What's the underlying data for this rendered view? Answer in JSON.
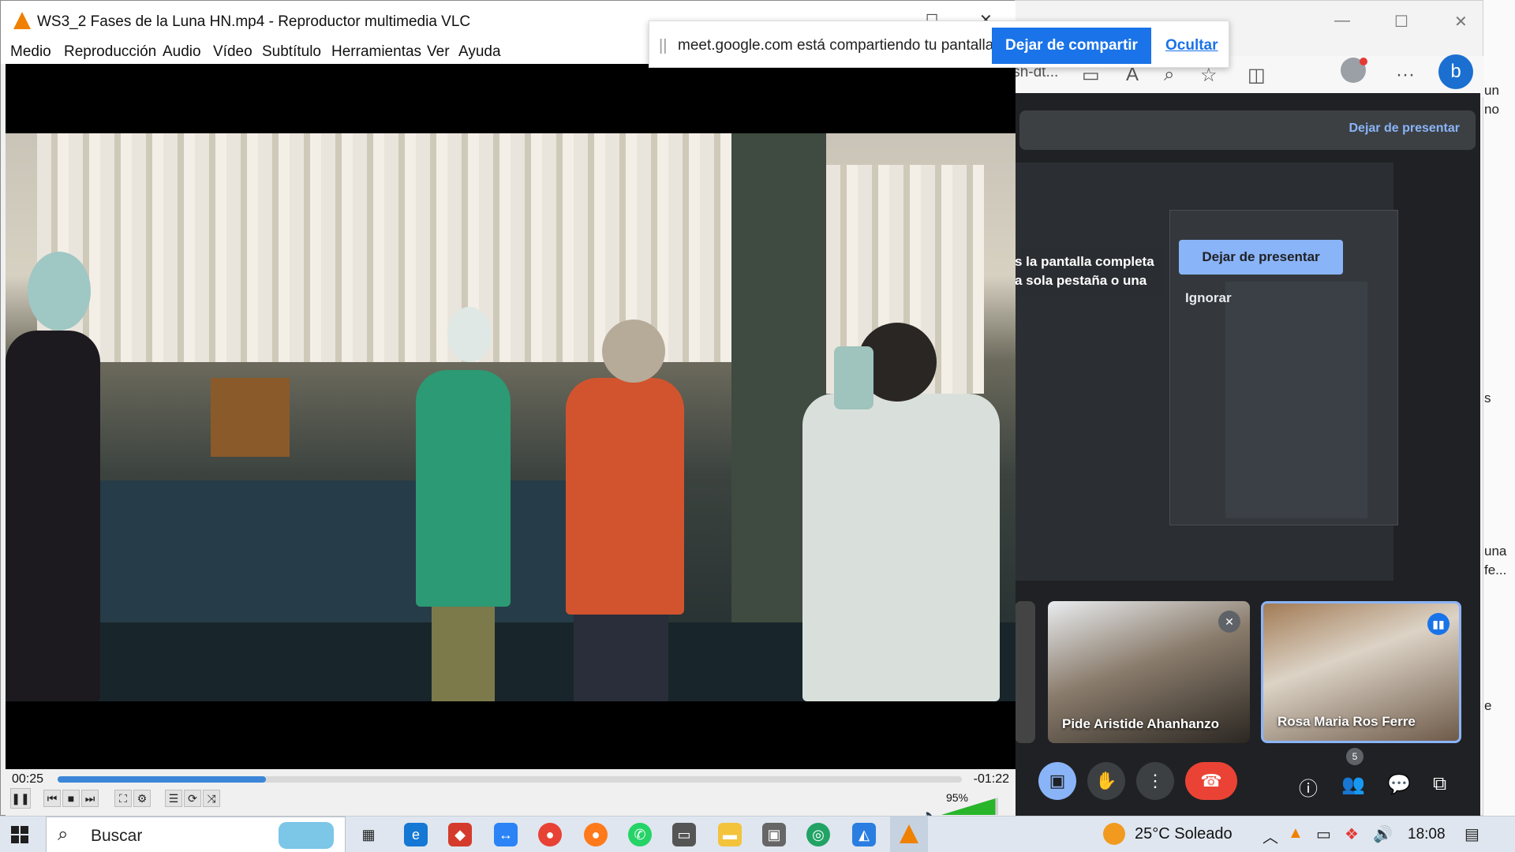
{
  "vlc": {
    "title": "WS3_2 Fases de la Luna HN.mp4 - Reproductor multimedia VLC",
    "menu": [
      "Medio",
      "Reproducción",
      "Audio",
      "Vídeo",
      "Subtítulo",
      "Herramientas",
      "Ver",
      "Ayuda"
    ],
    "elapsed": "00:25",
    "remaining": "-01:22",
    "progress": 0.23,
    "volume_label": "95%",
    "volume": 0.95
  },
  "share_banner": {
    "grip": "||",
    "text": "meet.google.com está compartiendo tu pantalla.",
    "stop_label": "Dejar de compartir",
    "hide_label": "Ocultar"
  },
  "edge": {
    "address_fragment": "ish-dt..."
  },
  "meet": {
    "stop_presenting_top": "Dejar de presentar",
    "dialog_text": "s la pantalla completa a sola pestaña o una",
    "stop_presenting_button": "Dejar de presentar",
    "ignore_label": "Ignorar",
    "participants": [
      {
        "name": "Pide Aristide Ahanhanzo"
      },
      {
        "name": "Rosa Maria Ros Ferre"
      }
    ],
    "people_count": "5"
  },
  "side_text": [
    "un",
    "no",
    "s",
    "una",
    "fe...",
    "e"
  ],
  "taskbar": {
    "search_placeholder": "Buscar",
    "weather": "25°C  Soleado",
    "time": "18:08"
  }
}
